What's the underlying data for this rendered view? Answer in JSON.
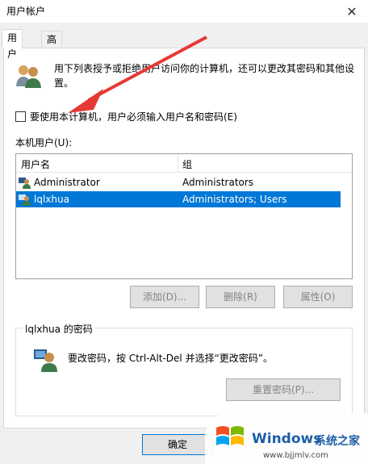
{
  "window": {
    "title": "用户帐户"
  },
  "tabs": [
    {
      "label": "用户",
      "active": true
    },
    {
      "label": "高级",
      "active": false
    }
  ],
  "intro_text": "用下列表授予或拒绝用户访问你的计算机，还可以更改其密码和其他设置。",
  "require_login_checkbox": {
    "label": "要使用本计算机，用户必须输入用户名和密码(E)",
    "checked": false
  },
  "user_list": {
    "label": "本机用户(U):",
    "columns": [
      "用户名",
      "组"
    ],
    "rows": [
      {
        "name": "Administrator",
        "group": "Administrators",
        "selected": false
      },
      {
        "name": "lqlxhua",
        "group": "Administrators; Users",
        "selected": true
      }
    ]
  },
  "buttons": {
    "add": "添加(D)...",
    "remove": "删除(R)",
    "properties": "属性(O)"
  },
  "password_group": {
    "title": "lqlxhua 的密码",
    "text": "要改密码，按 Ctrl-Alt-Del 并选择“更改密码”。",
    "reset_button": "重置密码(P)..."
  },
  "ok_button": "确定",
  "watermark": {
    "brand": "Windows",
    "brand_cn": "系统之家",
    "url": "www.bjjmlv.com"
  },
  "colors": {
    "selection": "#0078d7",
    "arrow": "#e53935",
    "watermark_blue": "#1e5fa8"
  }
}
